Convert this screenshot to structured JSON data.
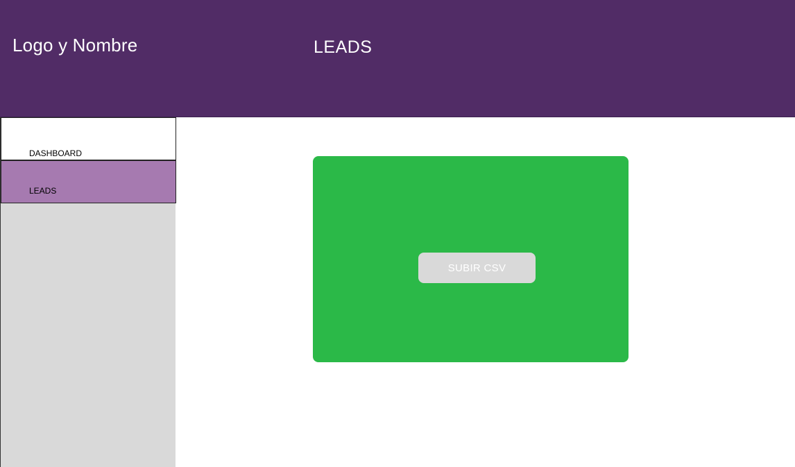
{
  "header": {
    "logo_text": "Logo y Nombre",
    "page_title": "LEADS"
  },
  "sidebar": {
    "items": [
      {
        "label": "DASHBOARD",
        "active": false
      },
      {
        "label": "LEADS",
        "active": true
      }
    ]
  },
  "main": {
    "upload_button_label": "SUBIR CSV"
  },
  "colors": {
    "header_bg": "#512C66",
    "active_nav_bg": "#A67AB0",
    "sidebar_bg": "#D9D9D9",
    "upload_panel_bg": "#2BB948",
    "button_bg": "#D9D9D9"
  }
}
